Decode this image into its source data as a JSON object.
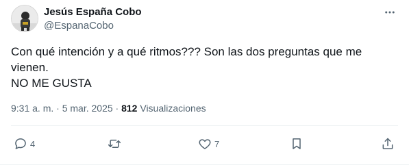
{
  "author": {
    "display_name": "Jesús España Cobo",
    "handle": "@EspanaCobo",
    "avatar_icon": "avatar-photo"
  },
  "more_icon": "more-horizontal-icon",
  "tweet": {
    "lines": [
      "Con qué intención y a qué ritmos??? Son las dos preguntas que me",
      "vienen.",
      "NO ME GUSTA"
    ]
  },
  "meta": {
    "time": "9:31 a. m.",
    "separator1": " · ",
    "date": "5 mar. 2025",
    "separator2": " · ",
    "views_count": "812",
    "views_label": " Visualizaciones"
  },
  "actions": {
    "reply": {
      "icon": "reply-icon",
      "count": "4"
    },
    "retweet": {
      "icon": "retweet-icon",
      "count": ""
    },
    "like": {
      "icon": "heart-icon",
      "count": "7"
    },
    "bookmark": {
      "icon": "bookmark-icon",
      "count": ""
    },
    "share": {
      "icon": "share-icon",
      "count": ""
    }
  },
  "colors": {
    "text_primary": "#0f1419",
    "text_secondary": "#536471",
    "divider": "#eff3f4"
  }
}
